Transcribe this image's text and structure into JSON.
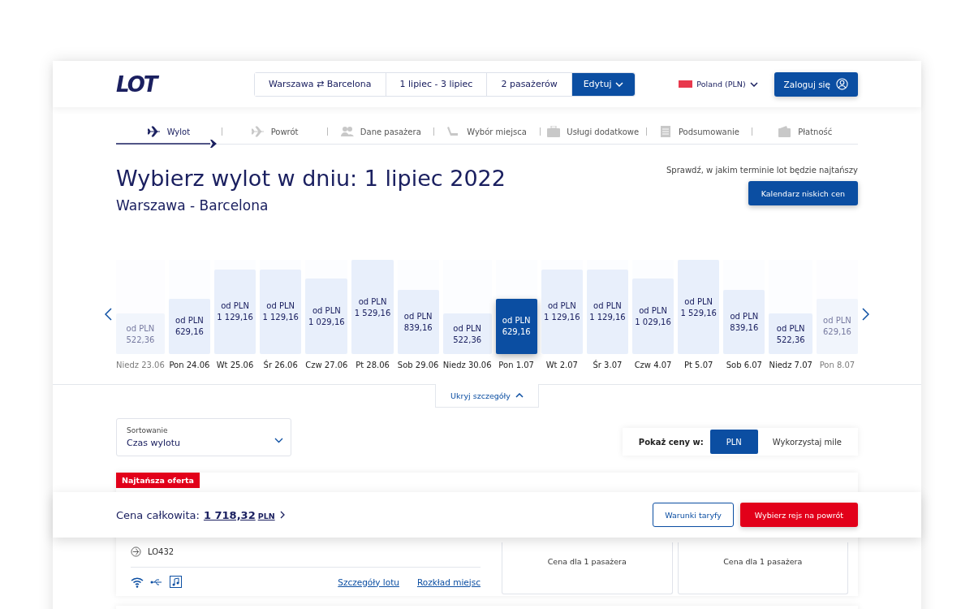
{
  "header": {
    "logo": "LOT",
    "search": {
      "from": "Warszawa",
      "swap": "⇄",
      "to": "Barcelona",
      "dates": "1 lipiec - 3 lipiec",
      "passengers": "2 pasażerów",
      "edit": "Edytuj"
    },
    "country": "Poland (PLN)",
    "login": "Zaloguj się"
  },
  "steps": [
    {
      "label": "Wylot",
      "kind": "plane",
      "selected": true
    },
    {
      "label": "Powrót",
      "kind": "plane",
      "selected": false
    },
    {
      "label": "Dane pasażera",
      "kind": "people",
      "selected": false
    },
    {
      "label": "Wybór miejsca",
      "kind": "seat",
      "selected": false
    },
    {
      "label": "Usługi dodatkowe",
      "kind": "bag",
      "selected": false
    },
    {
      "label": "Podsumowanie",
      "kind": "doc",
      "selected": false
    },
    {
      "label": "Płatność",
      "kind": "wallet",
      "selected": false
    }
  ],
  "title": "Wybierz wylot w dniu: 1 lipiec 2022",
  "route": "Warszawa - Barcelona",
  "calendar_hint": "Sprawdź, w jakim terminie lot będzie najtańszy",
  "calendar_button": "Kalendarz niskich cen",
  "days": [
    {
      "prefix": "od PLN",
      "price": "522,36",
      "date": "Niedz 23.06",
      "level": 0.43,
      "selected": false
    },
    {
      "prefix": "od PLN",
      "price": "629,16",
      "date": "Pon 24.06",
      "level": 0.59,
      "selected": false
    },
    {
      "prefix": "od PLN",
      "price": "1 129,16",
      "date": "Wt 25.06",
      "level": 0.9,
      "selected": false
    },
    {
      "prefix": "od PLN",
      "price": "1 129,16",
      "date": "Śr 26.06",
      "level": 0.9,
      "selected": false
    },
    {
      "prefix": "od PLN",
      "price": "1 029,16",
      "date": "Czw 27.06",
      "level": 0.8,
      "selected": false
    },
    {
      "prefix": "od PLN",
      "price": "1 529,16",
      "date": "Pt 28.06",
      "level": 1,
      "selected": false
    },
    {
      "prefix": "od PLN",
      "price": "839,16",
      "date": "Sob 29.06",
      "level": 0.68,
      "selected": false
    },
    {
      "prefix": "od PLN",
      "price": "522,36",
      "date": "Niedz 30.06",
      "level": 0.43,
      "selected": false
    },
    {
      "prefix": "od PLN",
      "price": "629,16",
      "date": "Pon 1.07",
      "level": 0.59,
      "selected": true
    },
    {
      "prefix": "od PLN",
      "price": "1 129,16",
      "date": "Wt 2.07",
      "level": 0.9,
      "selected": false
    },
    {
      "prefix": "od PLN",
      "price": "1 129,16",
      "date": "Śr 3.07",
      "level": 0.9,
      "selected": false
    },
    {
      "prefix": "od PLN",
      "price": "1 029,16",
      "date": "Czw 4.07",
      "level": 0.8,
      "selected": false
    },
    {
      "prefix": "od PLN",
      "price": "1 529,16",
      "date": "Pt 5.07",
      "level": 1,
      "selected": false
    },
    {
      "prefix": "od PLN",
      "price": "839,16",
      "date": "Sob 6.07",
      "level": 0.68,
      "selected": false
    },
    {
      "prefix": "od PLN",
      "price": "522,36",
      "date": "Niedz 7.07",
      "level": 0.43,
      "selected": false
    },
    {
      "prefix": "od PLN",
      "price": "629,16",
      "date": "Pon 8.07",
      "level": 0.59,
      "selected": false
    }
  ],
  "details_toggle": "Ukryj szczegóły",
  "sort": {
    "label": "Sortowanie",
    "value": "Czas wylotu"
  },
  "currency": {
    "label": "Pokaż ceny w:",
    "options": [
      {
        "label": "PLN",
        "selected": true
      },
      {
        "label": "Wykorzystaj mile",
        "selected": false
      }
    ]
  },
  "offer": {
    "badge": "Najtańsza oferta",
    "flight": "LO432",
    "links": [
      "Szczegóły lotu",
      "Rozkład miejsc"
    ],
    "fares": [
      {
        "note": "Cena dla 1 pasażera"
      },
      {
        "note": "Cena dla 1 pasażera"
      }
    ]
  },
  "footer": {
    "label": "Cena całkowita:",
    "amount": "1 718,32",
    "currency": "PLN",
    "terms": "Warunki taryfy",
    "next": "Wybierz rejs na powrót"
  }
}
